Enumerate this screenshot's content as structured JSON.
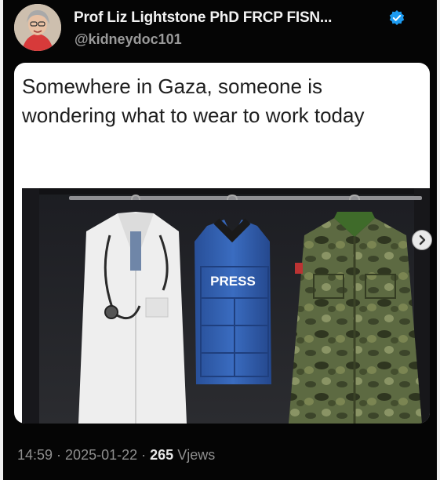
{
  "author": {
    "name": "Prof Liz Lightstone PhD FRCP FISN...",
    "handle": "@kidneydoc101"
  },
  "post": {
    "caption": "Somewhere in Gaza, someone is wondering what to wear to work today",
    "image_text": "PRESS"
  },
  "meta": {
    "time": "14:59",
    "date": "2025-01-22",
    "separator": "·",
    "views_count": "265",
    "views_label": "Vjews"
  },
  "colors": {
    "background": "#050505",
    "verified_badge": "#1d9bf0",
    "vest_blue": "#2f5fb0",
    "camo_green": "#5d6a42"
  },
  "icons": [
    "verified-badge-icon",
    "chevron-right-icon"
  ]
}
